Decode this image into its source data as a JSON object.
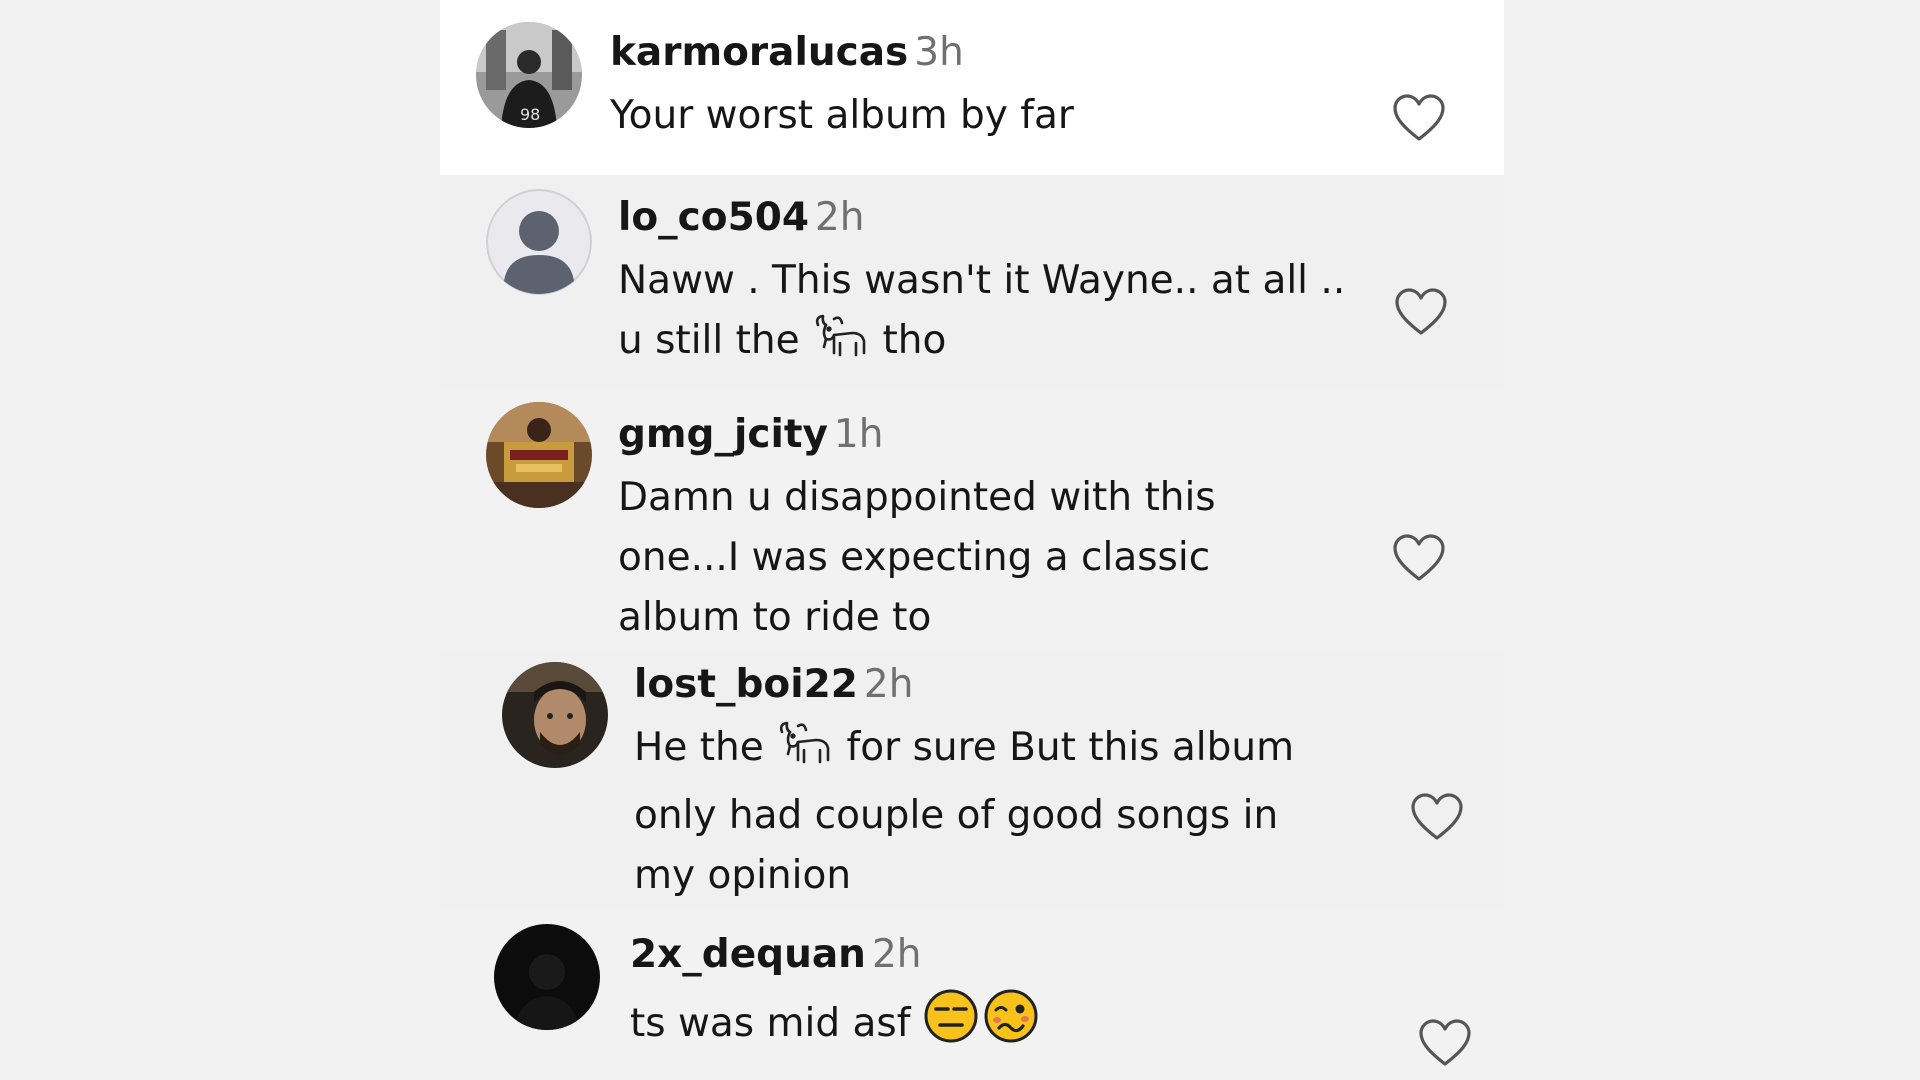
{
  "comments": [
    {
      "username": "karmoralucas",
      "time": "3h",
      "lines": [
        "Your worst album by far"
      ]
    },
    {
      "username": "lo_co504",
      "time": "2h",
      "lines": [
        "Naww . This wasn't it Wayne.. at all ..",
        "u still the",
        "tho"
      ]
    },
    {
      "username": "gmg_jcity",
      "time": "1h",
      "lines": [
        "Damn u disappointed with this",
        "one...I was expecting a classic",
        "album to ride to"
      ]
    },
    {
      "username": "lost_boi22",
      "time": "2h",
      "lines": [
        "He the",
        "for sure But this album",
        "only had couple of good songs in",
        "my opinion"
      ]
    },
    {
      "username": "2x_dequan",
      "time": "2h",
      "lines": [
        "ts was mid asf"
      ]
    }
  ],
  "icons": {
    "like": "heart-outline-icon",
    "goat": "goat-emoji-icon",
    "expressionless": "expressionless-face-emoji-icon",
    "woozy": "woozy-face-emoji-icon",
    "default_avatar": "default-avatar-icon"
  },
  "colors": {
    "background": "#f2f2f2",
    "highlight_row": "#ffffff",
    "text": "#161616",
    "timestamp": "#707070",
    "heart_outline": "#555555"
  }
}
